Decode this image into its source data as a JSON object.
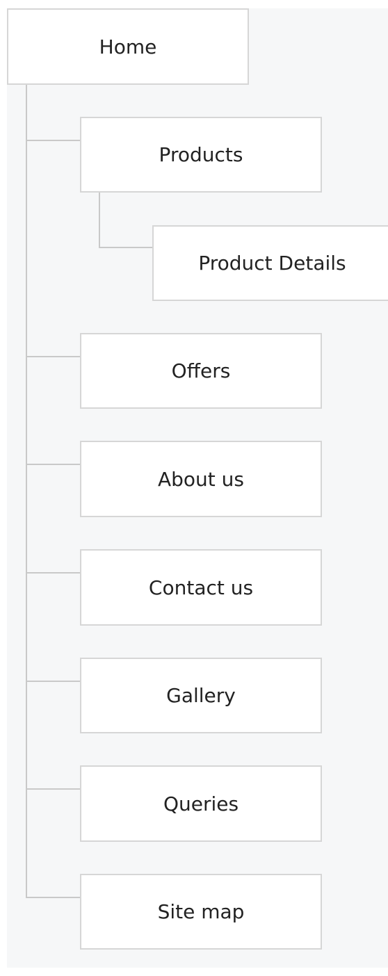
{
  "sitemap": {
    "root": {
      "label": "Home"
    },
    "children": [
      {
        "label": "Products",
        "children": [
          {
            "label": "Product Details"
          }
        ]
      },
      {
        "label": "Offers"
      },
      {
        "label": "About us"
      },
      {
        "label": "Contact us"
      },
      {
        "label": "Gallery"
      },
      {
        "label": "Queries"
      },
      {
        "label": "Site map"
      }
    ]
  },
  "colors": {
    "background": "#f6f7f8",
    "node_fill": "#ffffff",
    "node_border": "#d6d6d6",
    "connector": "#c9c9c9",
    "text": "#222222"
  }
}
